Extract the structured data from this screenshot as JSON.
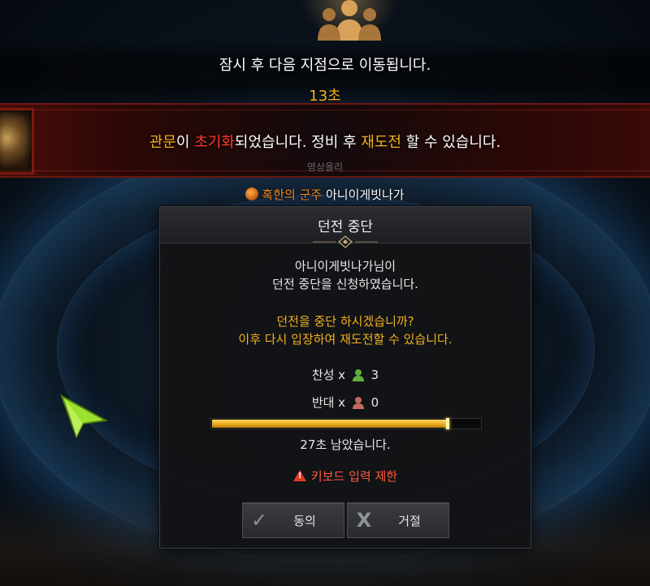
{
  "notice": {
    "move_message": "잠시 후 다음 지점으로 이동됩니다.",
    "countdown": "13초"
  },
  "reset_banner": {
    "part1": "관문",
    "part2": "이 ",
    "part3": "초기화",
    "part4": "되었습니다. 정비 후 ",
    "part5": "재도전",
    "part6": " 할 수 있습니다.",
    "faint_text": "영상올리"
  },
  "boss": {
    "title": "혹한의 군주",
    "name": " 아니이게빗나가"
  },
  "dialog": {
    "title": "던전 중단",
    "request_line1": "아니이게빗나가님이",
    "request_line2": "던전 중단을 신청하였습니다.",
    "question_line1": "던전을 중단 하시겠습니까?",
    "question_line2": "이후 다시 입장하여 재도전할 수 있습니다.",
    "agree_label": "찬성 x",
    "agree_count": "3",
    "oppose_label": "반대 x",
    "oppose_count": "0",
    "progress_fraction": 0.875,
    "time_remaining": "27초 남았습니다.",
    "keyboard_warning": "키보드 입력 제한",
    "agree_button": "동의",
    "reject_button": "거절"
  },
  "colors": {
    "gold": "#f3b11e",
    "red": "#ff3b2b",
    "agree_icon": "#5fae3b",
    "oppose_icon": "#c26a5c"
  }
}
